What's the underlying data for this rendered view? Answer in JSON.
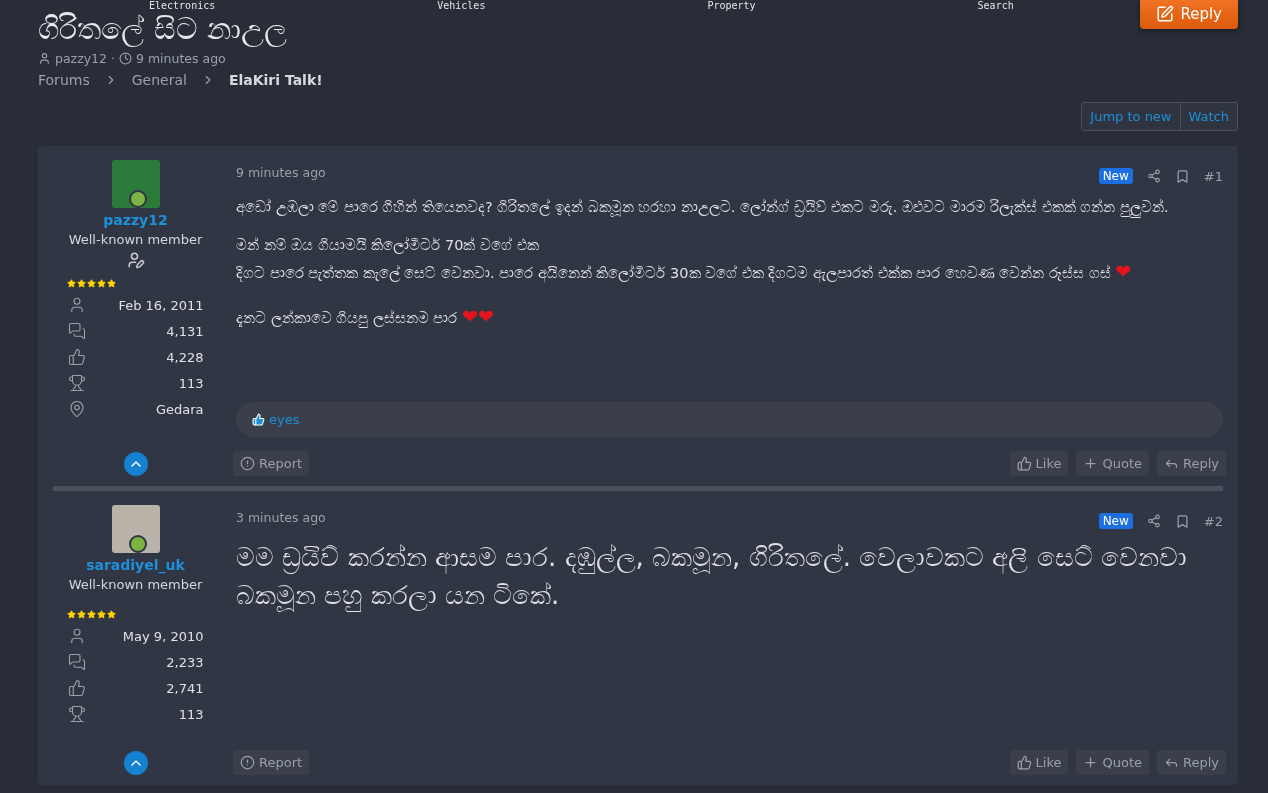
{
  "nav": [
    "Electronics",
    "Vehicles",
    "Property",
    "Search"
  ],
  "reply_button": "Reply",
  "thread": {
    "title": "ගිරිතලේ සිට නාඋල",
    "author": "pazzy12",
    "separator": "·",
    "time": "9 minutes ago"
  },
  "breadcrumbs": [
    {
      "label": "Forums",
      "current": false
    },
    {
      "label": "General",
      "current": false
    },
    {
      "label": "ElaKiri Talk!",
      "current": true
    }
  ],
  "thread_actions": [
    "Jump to new",
    "Watch"
  ],
  "posts": [
    {
      "author": {
        "name": "pazzy12",
        "title": "Well-known member",
        "editor_badge": true,
        "stars": 5,
        "stats": [
          {
            "kind": "joined",
            "value": "Feb 16, 2011"
          },
          {
            "kind": "messages",
            "value": "4,131"
          },
          {
            "kind": "reactions",
            "value": "4,228"
          },
          {
            "kind": "trophies",
            "value": "113"
          },
          {
            "kind": "location",
            "value": "Gedara"
          }
        ]
      },
      "time": "9 minutes ago",
      "new_badge": "New",
      "number": "#1",
      "kind": "normal",
      "paragraphs": [
        {
          "lines": [
            {
              "text": "අඩෝ උඹලා මේ පාරෙ ගිහින් තියෙනවද? ගිරිතලේ ඉදන් බකමූන හරහා නාඋලට. ලෝන්ග් ඩ්‍රයිව් එකට මරු. ඔළුවට මාරම රිලැක්ස් එකක් ගන්න පුලුවන්."
            }
          ]
        },
        {
          "lines": [
            {
              "text": "මන් නම් ඔය ගියාමයි කිලෝමීටර් 70ක් වගේ එක"
            },
            {
              "text": "දිගට පාරෙ පැත්තක කැලේ සෙට් වෙනවා. පාරෙ අයිනෙන් කිලෝමීටර් 30ක වගේ එක දිගටම ඇලපාරත් එක්ක පාර හෙවණ වෙන්න රූස්ස ගස්",
              "emoji": "❤"
            }
          ]
        },
        {
          "lines": [
            {
              "text": "දැනට ලන්කාවෙ ගියපු ලස්සනම පාර",
              "emoji": "❤❤"
            }
          ]
        }
      ],
      "reactions": "eyes",
      "actions": {
        "report": "Report",
        "like": "Like",
        "quote": "Quote",
        "reply": "Reply"
      }
    },
    {
      "author": {
        "name": "saradiyel_uk",
        "title": "Well-known member",
        "editor_badge": false,
        "stars": 5,
        "stats": [
          {
            "kind": "joined",
            "value": "May 9, 2010"
          },
          {
            "kind": "messages",
            "value": "2,233"
          },
          {
            "kind": "reactions",
            "value": "2,741"
          },
          {
            "kind": "trophies",
            "value": "113"
          }
        ]
      },
      "time": "3 minutes ago",
      "new_badge": "New",
      "number": "#2",
      "kind": "large",
      "paragraphs": [
        {
          "lines": [
            {
              "text": "මම ඩ්‍රයිව් කරන්න ආසම පාර. දඹුල්ල, බකමූන, ගිරිතලේ. වෙලාවකට අලි සෙට් වෙනවා බකමූන පහු කරලා යන ටිකේ."
            }
          ]
        }
      ],
      "actions": {
        "report": "Report",
        "like": "Like",
        "quote": "Quote",
        "reply": "Reply"
      }
    }
  ]
}
